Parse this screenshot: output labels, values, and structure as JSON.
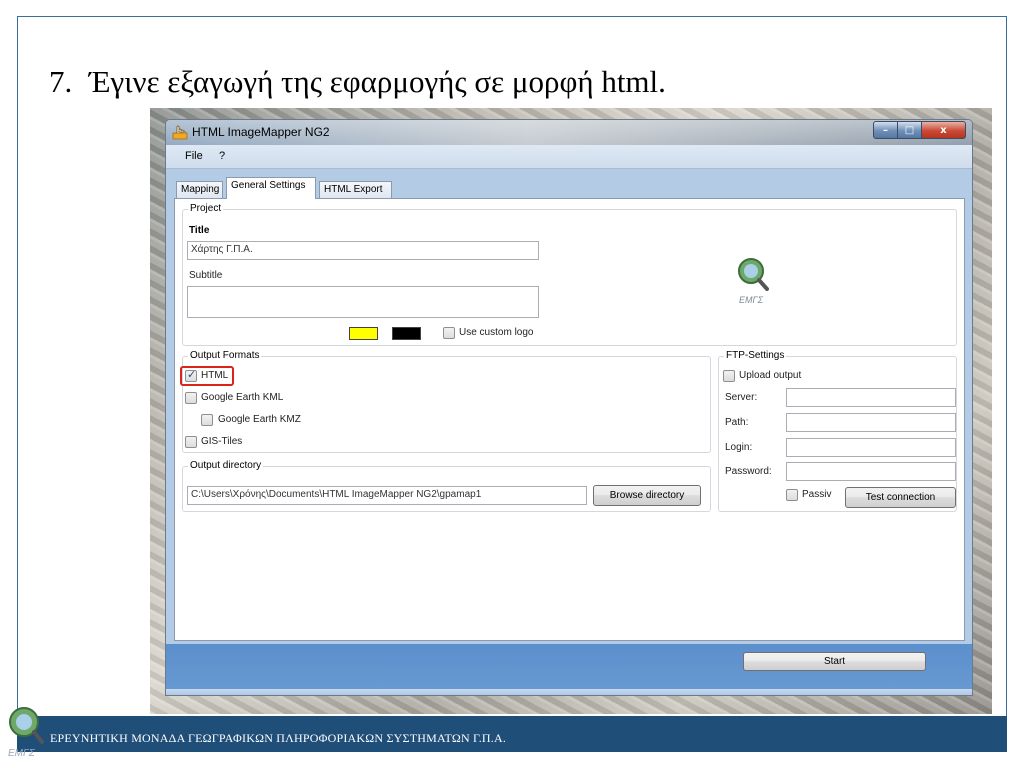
{
  "slide": {
    "heading_number": "7.",
    "heading_text": "Έγινε εξαγωγή της εφαρμογής σε μορφή html.",
    "footer_text": "ΕΡΕΥΝΗΤΙΚΗ ΜΟΝΑΔΑ ΓΕΩΓΡΑΦΙΚΩΝ ΠΛΗΡΟΦΟΡΙΑΚΩΝ ΣΥΣΤΗΜΑΤΩΝ Γ.Π.Α.",
    "logo_text": "ΕΜΓΣ"
  },
  "window": {
    "title": "HTML ImageMapper NG2",
    "controls": {
      "minimize": "–",
      "maximize": "□",
      "close": "x"
    }
  },
  "menu": {
    "file": "File",
    "help": "?"
  },
  "tabs": [
    {
      "label": "Mapping",
      "active": false
    },
    {
      "label": "General Settings",
      "active": true
    },
    {
      "label": "HTML Export",
      "active": false
    }
  ],
  "project": {
    "group_title": "Project",
    "title_label": "Title",
    "title_value": "Χάρτης Γ.Π.Α.",
    "subtitle_label": "Subtitle",
    "subtitle_value": "",
    "color1": "#ffff00",
    "color2": "#000000",
    "use_custom_logo_label": "Use custom logo",
    "use_custom_logo_checked": false
  },
  "output_formats": {
    "group_title": "Output Formats",
    "items": [
      {
        "label": "HTML",
        "checked": true
      },
      {
        "label": "Google Earth KML",
        "checked": false
      },
      {
        "label": "Google Earth KMZ",
        "checked": false
      },
      {
        "label": "GIS-Tiles",
        "checked": false
      }
    ]
  },
  "output_directory": {
    "group_title": "Output directory",
    "path": "C:\\Users\\Χρόνης\\Documents\\HTML ImageMapper NG2\\gpamap1",
    "browse_label": "Browse directory"
  },
  "ftp": {
    "group_title": "FTP-Settings",
    "upload_label": "Upload output",
    "upload_checked": false,
    "server_label": "Server:",
    "path_label": "Path:",
    "login_label": "Login:",
    "password_label": "Password:",
    "passiv_label": "Passiv",
    "passiv_checked": false,
    "test_label": "Test connection"
  },
  "start_label": "Start",
  "colors": {
    "accent_blue": "#1f4e79",
    "highlight_red": "#d9241a"
  }
}
